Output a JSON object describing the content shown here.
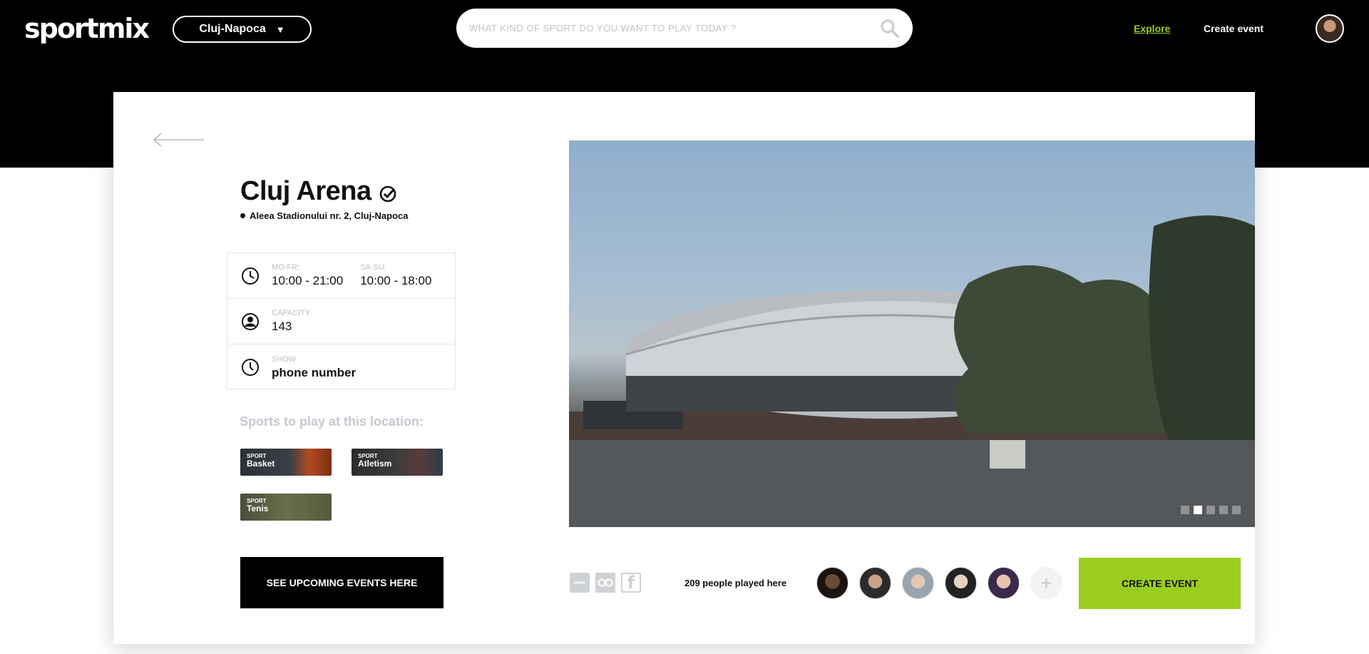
{
  "header": {
    "logo": "sportmix",
    "city": "Cluj-Napoca",
    "search_placeholder": "WHAT KIND OF SPORT DO YOU WANT TO PLAY TODAY ?",
    "nav_explore": "Explore",
    "nav_create_event": "Create event"
  },
  "venue": {
    "name": "Cluj Arena",
    "address": "Aleea Stadionului nr. 2, Cluj-Napoca",
    "hours": {
      "weekday_label": "MO-FR:",
      "weekday_value": "10:00 - 21:00",
      "weekend_label": "SA-SU:",
      "weekend_value": "10:00 - 18:00"
    },
    "capacity_label": "CAPACITY",
    "capacity_value": "143",
    "phone_label": "SHOW",
    "phone_value": "phone number"
  },
  "sports": {
    "heading": "Sports to play at this location:",
    "tiles": [
      {
        "small": "SPORT",
        "name": "Basket"
      },
      {
        "small": "SPORT",
        "name": "Atletism"
      },
      {
        "small": "SPORT",
        "name": "Tenis"
      }
    ]
  },
  "actions": {
    "upcoming_events": "SEE UPCOMING EVENTS HERE",
    "create_event": "CREATE EVENT"
  },
  "gallery": {
    "slides_total": 5,
    "active_slide": 2
  },
  "social": {
    "www": "www",
    "tripadvisor": "tripadvisor",
    "facebook": "f"
  },
  "community": {
    "played_text": "209 people played here",
    "add_symbol": "+"
  },
  "colors": {
    "accent": "#9acd1f",
    "header_bg": "#000000"
  }
}
